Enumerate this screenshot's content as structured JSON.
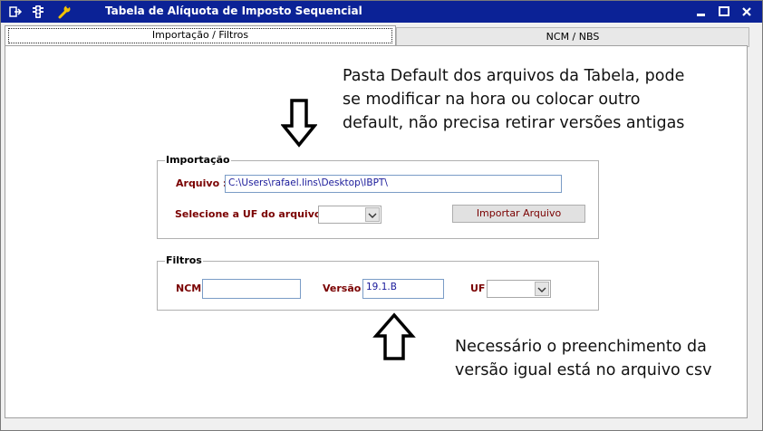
{
  "window": {
    "title": "Tabela de Alíquota de Imposto Sequencial"
  },
  "tabs": [
    {
      "label": "Importação / Filtros"
    },
    {
      "label": "NCM / NBS"
    }
  ],
  "note_top": [
    "Pasta Default dos arquivos da Tabela, pode",
    "se modificar na hora ou colocar outro",
    "default, não precisa retirar versões antigas"
  ],
  "importacao": {
    "legend": "Importação",
    "arquivo_label": "Arquivo :",
    "arquivo_value": "C:\\Users\\rafael.lins\\Desktop\\IBPT\\",
    "uf_label": "Selecione a UF do arquivo :",
    "uf_value": "",
    "import_button": "Importar Arquivo"
  },
  "filtros": {
    "legend": "Filtros",
    "ncm_label": "NCM",
    "ncm_value": "",
    "versao_label": "Versão",
    "versao_value": "19.1.B",
    "uf_label": "UF",
    "uf_value": ""
  },
  "note_bottom": [
    "Necessário o preenchimento da",
    "versão igual está no arquivo csv"
  ],
  "colors": {
    "titlebar": "#0b2296",
    "label": "#7a0000"
  }
}
